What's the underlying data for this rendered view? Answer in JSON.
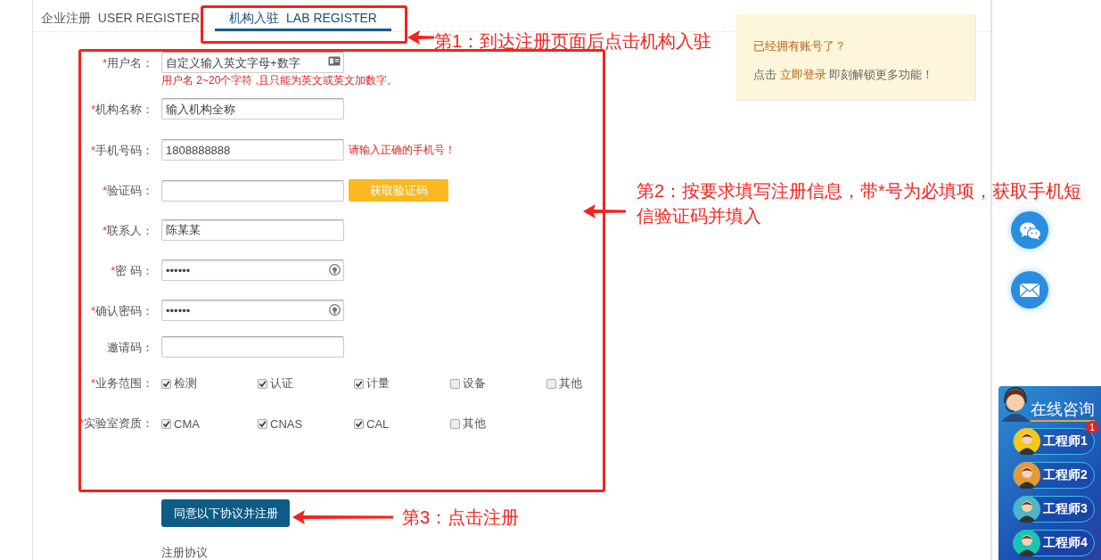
{
  "tabs": [
    {
      "label": "企业注册  USER REGISTER",
      "selected": false
    },
    {
      "label": "机构入驻  LAB REGISTER",
      "selected": true
    }
  ],
  "form": {
    "fields": [
      {
        "kind": "account",
        "required_mark": "*",
        "label": "用户名：",
        "placeholder": "自定义输入英文字母+数字",
        "hint": "用户名 2~20个字符 ,且只能为英文或英文加数字。"
      },
      {
        "kind": "text",
        "required_mark": "*",
        "label": "机构名称：",
        "placeholder": "输入机构全称"
      },
      {
        "kind": "text",
        "required_mark": "*",
        "label": "手机号码：",
        "value": "1808888888",
        "error": "请输入正确的手机号！"
      },
      {
        "kind": "code",
        "required_mark": "*",
        "label": "验证码：",
        "button": "获取验证码"
      },
      {
        "kind": "text",
        "required_mark": "*",
        "label": "联系人：",
        "value": "陈某某"
      },
      {
        "kind": "password",
        "required_mark": "*",
        "label": "密 码：",
        "value": "••••••"
      },
      {
        "kind": "password",
        "required_mark": "*",
        "label": "确认密码：",
        "value": "••••••"
      },
      {
        "kind": "text",
        "label": "邀请码："
      }
    ],
    "groups": [
      {
        "required_mark": "*",
        "label": "业务范围：",
        "options": [
          {
            "label": "检测",
            "checked": true
          },
          {
            "label": "认证",
            "checked": true
          },
          {
            "label": "计量",
            "checked": true
          },
          {
            "label": "设备",
            "checked": false
          },
          {
            "label": "其他",
            "checked": false
          }
        ]
      },
      {
        "required_mark": "*",
        "label": "实验室资质：",
        "options": [
          {
            "label": "CMA",
            "checked": true
          },
          {
            "label": "CNAS",
            "checked": true
          },
          {
            "label": "CAL",
            "checked": true
          },
          {
            "label": "其他",
            "checked": false
          }
        ]
      }
    ],
    "submit": "同意以下协议并注册",
    "agreement_link": "注册协议"
  },
  "login_card": {
    "title": "已经拥有账号了？",
    "text_before": "点击",
    "link": "立即登录",
    "text_after": "即刻解锁更多功能！"
  },
  "float_buttons": [
    {
      "kind": "wechat"
    },
    {
      "kind": "mail"
    }
  ],
  "consult": {
    "title": "在线咨询",
    "badge": "1",
    "agents": [
      {
        "name": "工程师1",
        "color": "#f2c81c"
      },
      {
        "name": "工程师2",
        "color": "#e59a38"
      },
      {
        "name": "工程师3",
        "color": "#4cb6c4"
      },
      {
        "name": "工程师4",
        "color": "#1bc4b0"
      }
    ]
  },
  "annotations": [
    {
      "text": "第1：到达注册页面后点击机构入驻"
    },
    {
      "text": "第2：按要求填写注册信息，带*号为必填项，获取手机短信验证码并填入"
    },
    {
      "text": "第3：点击注册"
    }
  ]
}
